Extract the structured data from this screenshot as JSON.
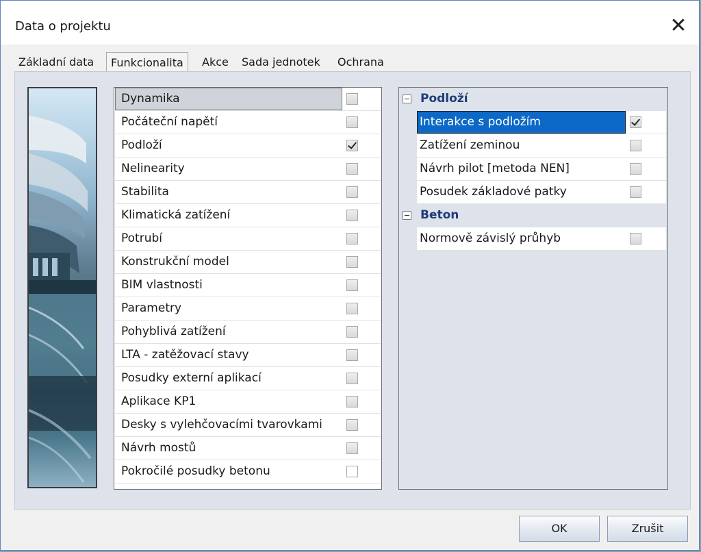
{
  "dialog": {
    "title": "Data o projektu",
    "close_glyph": "✕"
  },
  "tabs": [
    {
      "label": "Základní data",
      "active": false
    },
    {
      "label": "Funkcionalita",
      "active": true
    },
    {
      "label": "Akce",
      "active": false
    },
    {
      "label": "Sada jednotek",
      "active": false
    },
    {
      "label": "Ochrana",
      "active": false
    }
  ],
  "functionality_list": [
    {
      "label": "Dynamika",
      "checked": false,
      "selected": true
    },
    {
      "label": "Počáteční napětí",
      "checked": false
    },
    {
      "label": "Podloží",
      "checked": true
    },
    {
      "label": "Nelinearity",
      "checked": false
    },
    {
      "label": "Stabilita",
      "checked": false
    },
    {
      "label": "Klimatická zatížení",
      "checked": false
    },
    {
      "label": "Potrubí",
      "checked": false
    },
    {
      "label": "Konstrukční model",
      "checked": false
    },
    {
      "label": "BIM vlastnosti",
      "checked": false
    },
    {
      "label": "Parametry",
      "checked": false
    },
    {
      "label": "Pohyblivá zatížení",
      "checked": false
    },
    {
      "label": "LTA - zatěžovací stavy",
      "checked": false
    },
    {
      "label": "Posudky externí aplikací",
      "checked": false
    },
    {
      "label": "Aplikace KP1",
      "checked": false
    },
    {
      "label": "Desky s vylehčovacími tvarovkami",
      "checked": false
    },
    {
      "label": "Návrh mostů",
      "checked": false
    },
    {
      "label": "Pokročilé posudky betonu",
      "checked": false
    }
  ],
  "property_tree": [
    {
      "group": "Podloží",
      "items": [
        {
          "label": "Interakce s podložím",
          "checked": true,
          "selected": true
        },
        {
          "label": "Zatížení zeminou",
          "checked": false
        },
        {
          "label": "Návrh pilot [metoda NEN]",
          "checked": false
        },
        {
          "label": "Posudek základové patky",
          "checked": false
        }
      ]
    },
    {
      "group": "Beton",
      "items": [
        {
          "label": "Normově závislý průhyb",
          "checked": false
        }
      ]
    }
  ],
  "buttons": {
    "ok": "OK",
    "cancel": "Zrušit"
  }
}
